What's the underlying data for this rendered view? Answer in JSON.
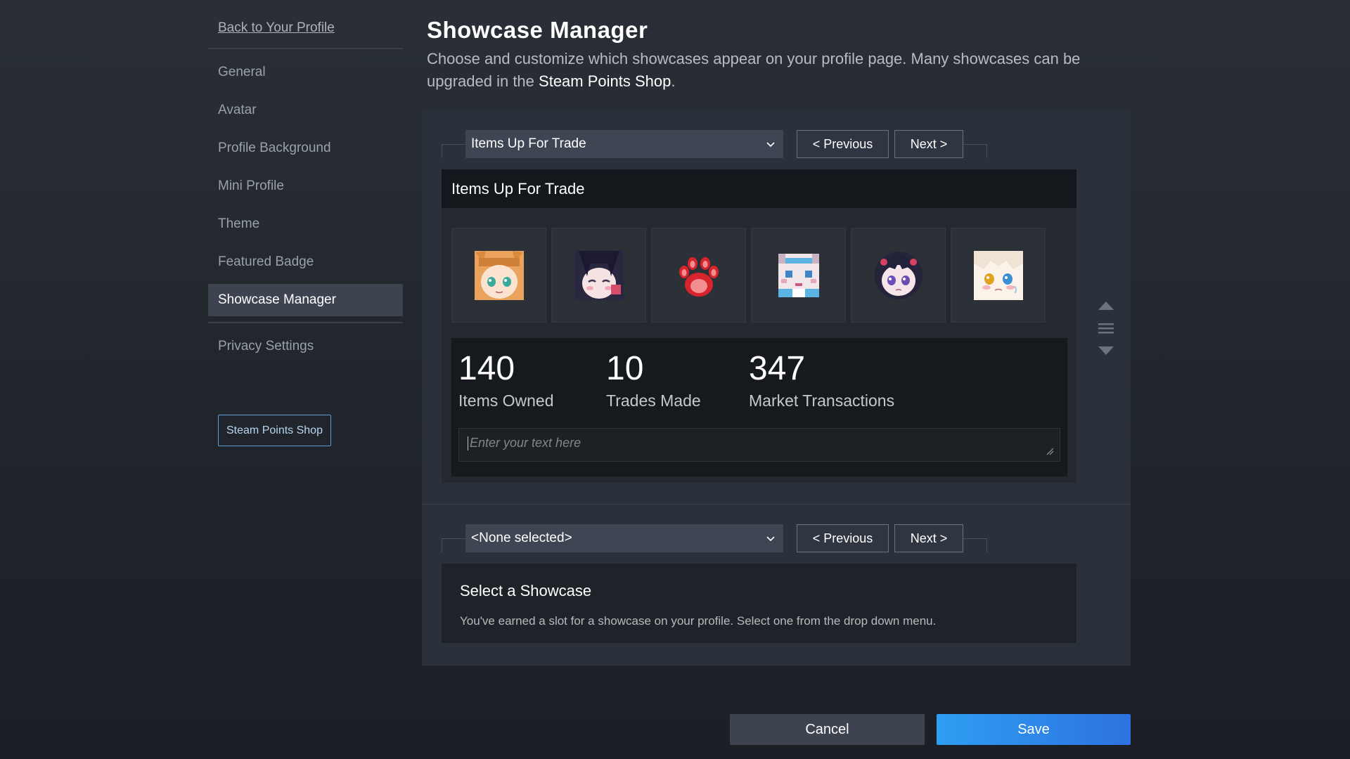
{
  "sidebar": {
    "back_link": "Back to Your Profile",
    "items": [
      {
        "label": "General"
      },
      {
        "label": "Avatar"
      },
      {
        "label": "Profile Background"
      },
      {
        "label": "Mini Profile"
      },
      {
        "label": "Theme"
      },
      {
        "label": "Featured Badge"
      },
      {
        "label": "Showcase Manager",
        "active": true
      }
    ],
    "privacy": "Privacy Settings",
    "points_shop_button": "Steam Points Shop"
  },
  "header": {
    "title": "Showcase Manager",
    "description_prefix": "Choose and customize which showcases appear on your profile page. Many showcases can be upgraded in the ",
    "description_link": "Steam Points Shop",
    "description_suffix": "."
  },
  "slot1": {
    "selected": "Items Up For Trade",
    "prev": "< Previous",
    "next": "Next >",
    "showcase_title": "Items Up For Trade",
    "items": [
      {
        "icon": "anime-girl-orange-emoticon-icon"
      },
      {
        "icon": "anime-girl-dark-hair-emoticon-icon"
      },
      {
        "icon": "red-paw-emoticon-icon"
      },
      {
        "icon": "pixel-girl-emoticon-icon"
      },
      {
        "icon": "anime-girl-purple-eyes-emoticon-icon"
      },
      {
        "icon": "anime-girl-blonde-emoticon-icon"
      }
    ],
    "stats": [
      {
        "value": "140",
        "label": "Items Owned"
      },
      {
        "value": "10",
        "label": "Trades Made"
      },
      {
        "value": "347",
        "label": "Market Transactions"
      }
    ],
    "text_placeholder": "Enter your text here"
  },
  "slot2": {
    "selected": "<None selected>",
    "prev": "< Previous",
    "next": "Next >",
    "empty_title": "Select a Showcase",
    "empty_desc": "You've earned a slot for a showcase on your profile. Select one from the drop down menu."
  },
  "footer": {
    "cancel": "Cancel",
    "save": "Save"
  },
  "colors": {
    "accent": "#2e9ef2",
    "panel": "#2b313a",
    "active_nav": "#3d4450"
  }
}
